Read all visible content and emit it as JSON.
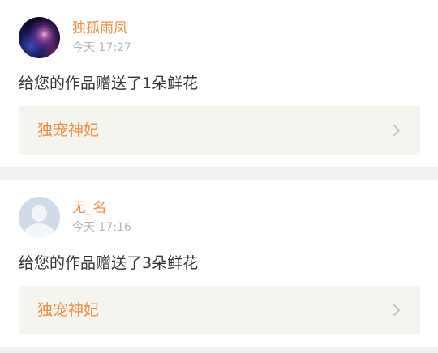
{
  "notifications": [
    {
      "avatar": "galaxy-avatar",
      "username": "独孤雨凤",
      "time": "今天 17:27",
      "message": "给您的作品赠送了1朵鲜花",
      "work_title": "独宠神妃",
      "chevron_icon": "chevron-right-icon"
    },
    {
      "avatar": "default-user-avatar",
      "username": "无_名",
      "time": "今天 17:16",
      "message": "给您的作品赠送了3朵鲜花",
      "work_title": "独宠神妃",
      "chevron_icon": "chevron-right-icon"
    }
  ],
  "colors": {
    "accent": "#f08c3d",
    "timestamp": "#b5b5b5",
    "message_text": "#333333",
    "link_background": "#f4f5ef",
    "page_background": "#f2f2f2"
  }
}
